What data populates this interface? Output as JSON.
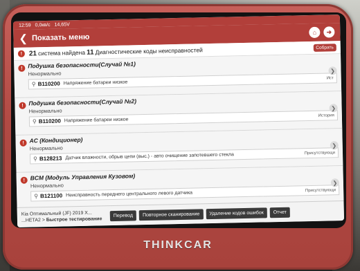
{
  "status": {
    "time": "12:59",
    "data": "0,0кв/с",
    "voltage": "14,65V"
  },
  "header": {
    "title": "Показать меню",
    "home_icon": "home-icon",
    "exit_icon": "exit-icon"
  },
  "summary": {
    "count_systems": "21",
    "text_systems": "система найдена",
    "count_codes": "11",
    "text_codes": "Диагностические коды неисправностей",
    "collect_label": "Собрать"
  },
  "systems": [
    {
      "name": "Подушка безопасности(Случай №1)",
      "state": "Ненормально",
      "dtc": "B110200",
      "description": "Напряжение батареи низкое",
      "tag": "Ист"
    },
    {
      "name": "Подушка безопасности(Случай №2)",
      "state": "Ненормально",
      "dtc": "B110200",
      "description": "Напряжение батареи низкое",
      "tag": "История"
    },
    {
      "name": "AC (Кондиционер)",
      "state": "Ненормально",
      "dtc": "B128213",
      "description": "Датчик влажности, обрыв цепи (выс.) - авто очищение запотевшего стекла",
      "tag": "Присутствующи"
    },
    {
      "name": "BCM (Модуль Управления Кузовом)",
      "state": "Ненормально",
      "dtc": "B121100",
      "description": "Неисправность переднего центрального левого датчика",
      "tag": "Присутствующи"
    }
  ],
  "footer": {
    "vin_line1": "Kia  Оптимальный (JF) 2019  X...",
    "vin_line2": "...HETA2 >",
    "vin_bold": "Быстрое тестирование",
    "buttons": [
      "Перевод",
      "Повторное сканирование",
      "Удаление кодов ошибок",
      "Отчет"
    ]
  },
  "brand": "THINKCAR",
  "colors": {
    "accent": "#b23f3a",
    "device_body": "#b14a44",
    "warning": "#c0392b"
  }
}
